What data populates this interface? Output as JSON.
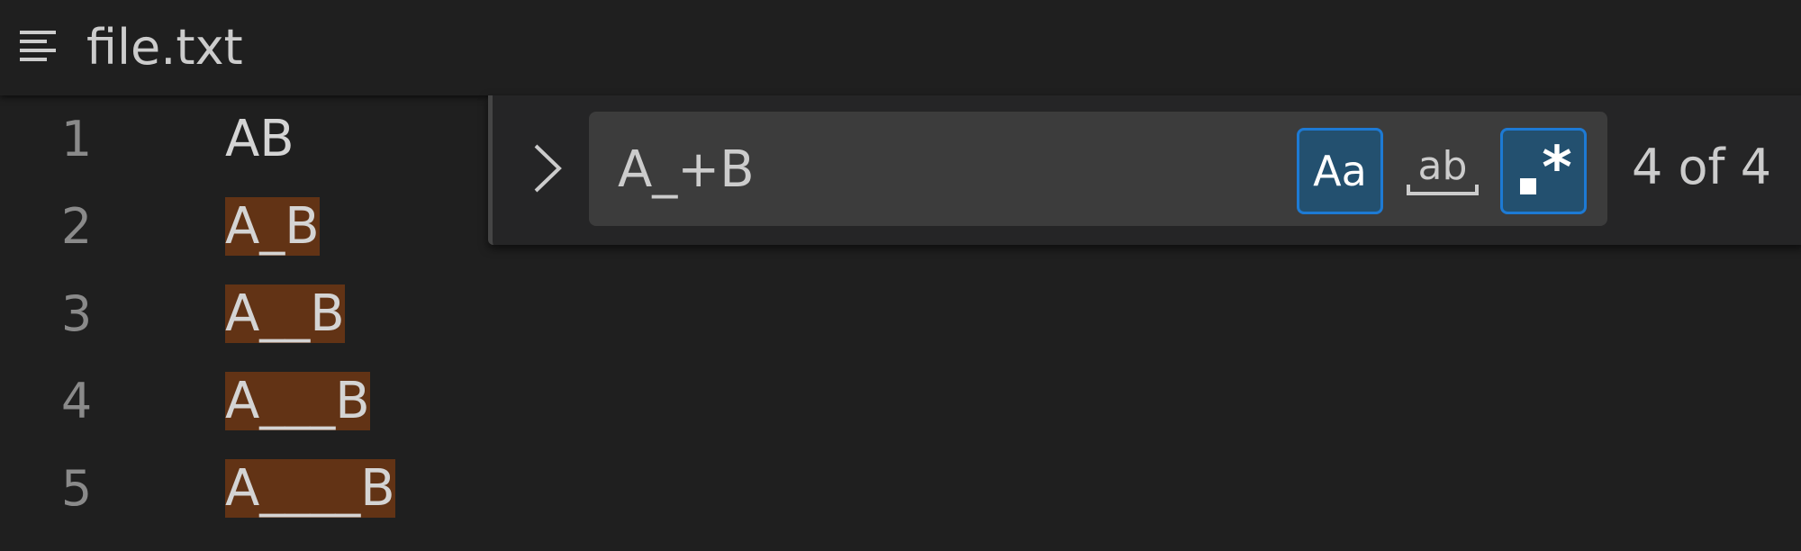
{
  "header": {
    "file_name": "file.txt",
    "icon": "outline-icon"
  },
  "editor": {
    "lines": [
      {
        "number": "1",
        "prefix": "AB",
        "match": "",
        "suffix": ""
      },
      {
        "number": "2",
        "prefix": "",
        "match": "A_B",
        "suffix": ""
      },
      {
        "number": "3",
        "prefix": "",
        "match": "A__B",
        "suffix": ""
      },
      {
        "number": "4",
        "prefix": "",
        "match": "A___B",
        "suffix": ""
      },
      {
        "number": "5",
        "prefix": "",
        "match": "A____B",
        "suffix": ""
      }
    ]
  },
  "find": {
    "query": "A_+B",
    "placeholder": "Find",
    "match_case_label": "Aa",
    "whole_word_label": "ab",
    "regex_label": ".*",
    "match_count": "4 of 4",
    "match_case_active": true,
    "whole_word_active": false,
    "regex_active": true
  },
  "colors": {
    "background": "#1f1f1f",
    "match_highlight": "#623315",
    "active_option": "#23506f",
    "active_option_border": "#1d7ad4"
  }
}
